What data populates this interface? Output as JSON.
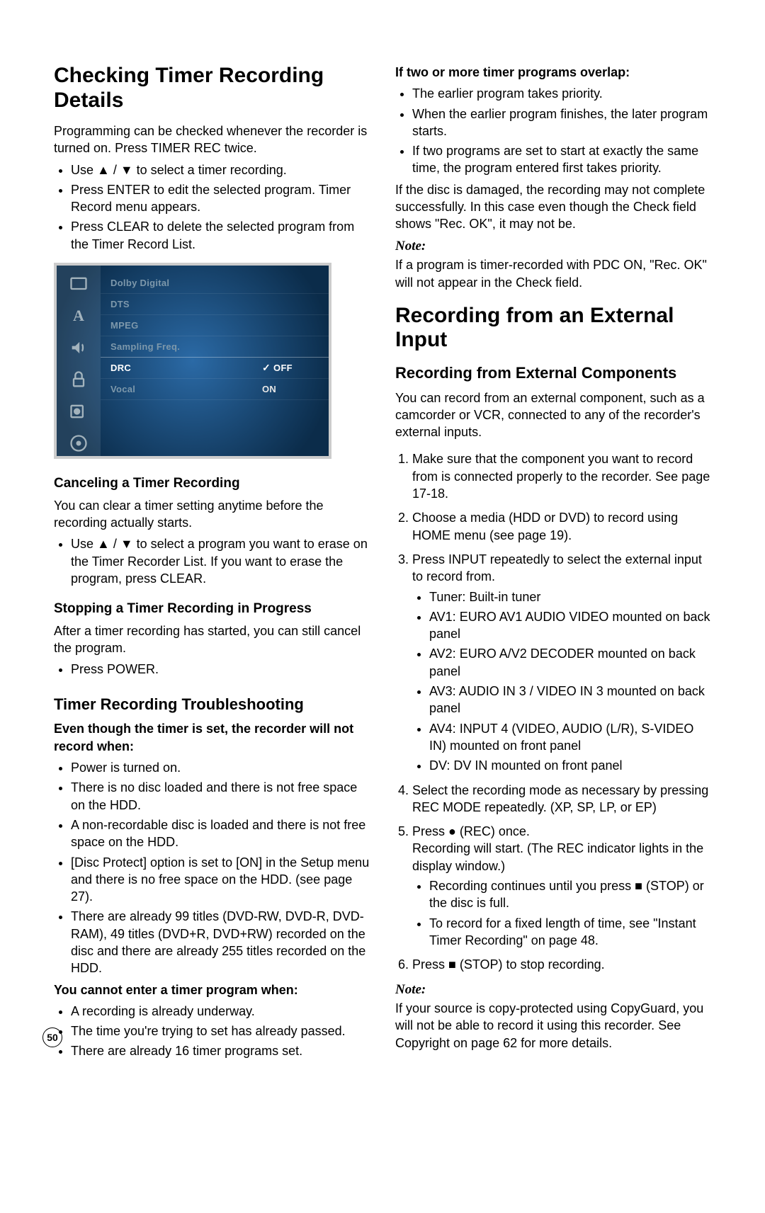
{
  "page_number": "50",
  "left": {
    "h1": "Checking Timer Recording Details",
    "intro": "Programming can be checked whenever the recorder is turned on. Press TIMER REC twice.",
    "intro_bullets": [
      "Use ▲ / ▼ to select a timer recording.",
      "Press ENTER to edit the selected program. Timer Record menu appears.",
      "Press CLEAR to delete the selected program from the Timer Record List."
    ],
    "menu": {
      "rows": [
        {
          "label": "Dolby Digital",
          "value": ""
        },
        {
          "label": "DTS",
          "value": ""
        },
        {
          "label": "MPEG",
          "value": ""
        },
        {
          "label": "Sampling Freq.",
          "value": ""
        },
        {
          "label": "DRC",
          "value": "OFF",
          "checked": true,
          "selected": true
        },
        {
          "label": "Vocal",
          "value": "ON"
        }
      ],
      "sidebar_icons": [
        "tv-icon",
        "language-icon",
        "audio-icon",
        "lock-icon",
        "record-icon",
        "disc-icon"
      ]
    },
    "h3_cancel": "Canceling a Timer Recording",
    "cancel_p": "You can clear a timer setting anytime before the recording actually starts.",
    "cancel_bullets": [
      "Use ▲ / ▼ to select a program you want to erase on the Timer Recorder List. If you want to erase the program, press CLEAR."
    ],
    "h3_stop": "Stopping a Timer Recording in Progress",
    "stop_p": "After a timer recording has started, you can still cancel the program.",
    "stop_bullets": [
      "Press POWER."
    ],
    "h2_trouble": "Timer Recording Troubleshooting",
    "trouble_lead1": "Even though the timer is set, the recorder will not record when:",
    "trouble_bullets1": [
      "Power is turned on.",
      "There is no disc loaded and there is not free space on the HDD.",
      "A non-recordable disc is loaded and there is not free space on the HDD.",
      "[Disc Protect] option is set to [ON] in the Setup menu and there is no free space on the HDD. (see page 27).",
      "There are already 99 titles (DVD-RW, DVD-R, DVD-RAM), 49 titles (DVD+R, DVD+RW) recorded on the disc and there are already 255 titles recorded on the HDD."
    ],
    "trouble_lead2": "You cannot enter a timer program when:",
    "trouble_bullets2": [
      "A recording is already underway.",
      "The time you're trying to set has already passed.",
      "There are already 16 timer programs set."
    ]
  },
  "right": {
    "overlap_lead": "If two or more timer programs overlap:",
    "overlap_bullets": [
      "The earlier program takes priority.",
      "When the earlier program finishes, the later program starts.",
      "If two programs are set to start at exactly the same time, the program entered first takes priority."
    ],
    "overlap_p": "If the disc is damaged, the recording may not complete successfully. In this case even though the Check field shows \"Rec. OK\", it may not be.",
    "note1_label": "Note:",
    "note1_body": "If a program is timer-recorded with PDC ON, \"Rec. OK\" will not appear in the Check field.",
    "h1_ext": "Recording from an External Input",
    "h2_ext": "Recording from External Components",
    "ext_p": "You can record from an external component, such as a camcorder or VCR, connected to any of the recorder's external inputs.",
    "steps": {
      "s1": "Make sure that the component you want to record from is connected properly to the recorder. See page 17-18.",
      "s2": "Choose a media (HDD or DVD) to record using HOME menu (see page 19).",
      "s3": "Press INPUT repeatedly to select the external input to record from.",
      "s3_sub": [
        "Tuner: Built-in tuner",
        "AV1: EURO AV1 AUDIO VIDEO mounted on back panel",
        "AV2: EURO A/V2 DECODER mounted on back panel",
        "AV3: AUDIO IN 3 / VIDEO IN 3 mounted on back panel",
        "AV4: INPUT 4 (VIDEO, AUDIO (L/R), S-VIDEO IN) mounted on front panel",
        "DV: DV IN mounted on front panel"
      ],
      "s4": "Select the recording mode as necessary by pressing REC MODE repeatedly. (XP, SP, LP, or EP)",
      "s5a": "Press ● (REC) once.",
      "s5b": "Recording will start. (The REC indicator lights in the display window.)",
      "s5_sub": [
        "Recording continues until you press ■ (STOP) or the disc is full.",
        "To record for a fixed length of time, see \"Instant Timer Recording\" on page 48."
      ],
      "s6": "Press ■ (STOP) to stop recording."
    },
    "note2_label": "Note:",
    "note2_body": "If your source is copy-protected using CopyGuard, you will not be able to record it using this recorder. See Copyright on page 62 for more details."
  }
}
